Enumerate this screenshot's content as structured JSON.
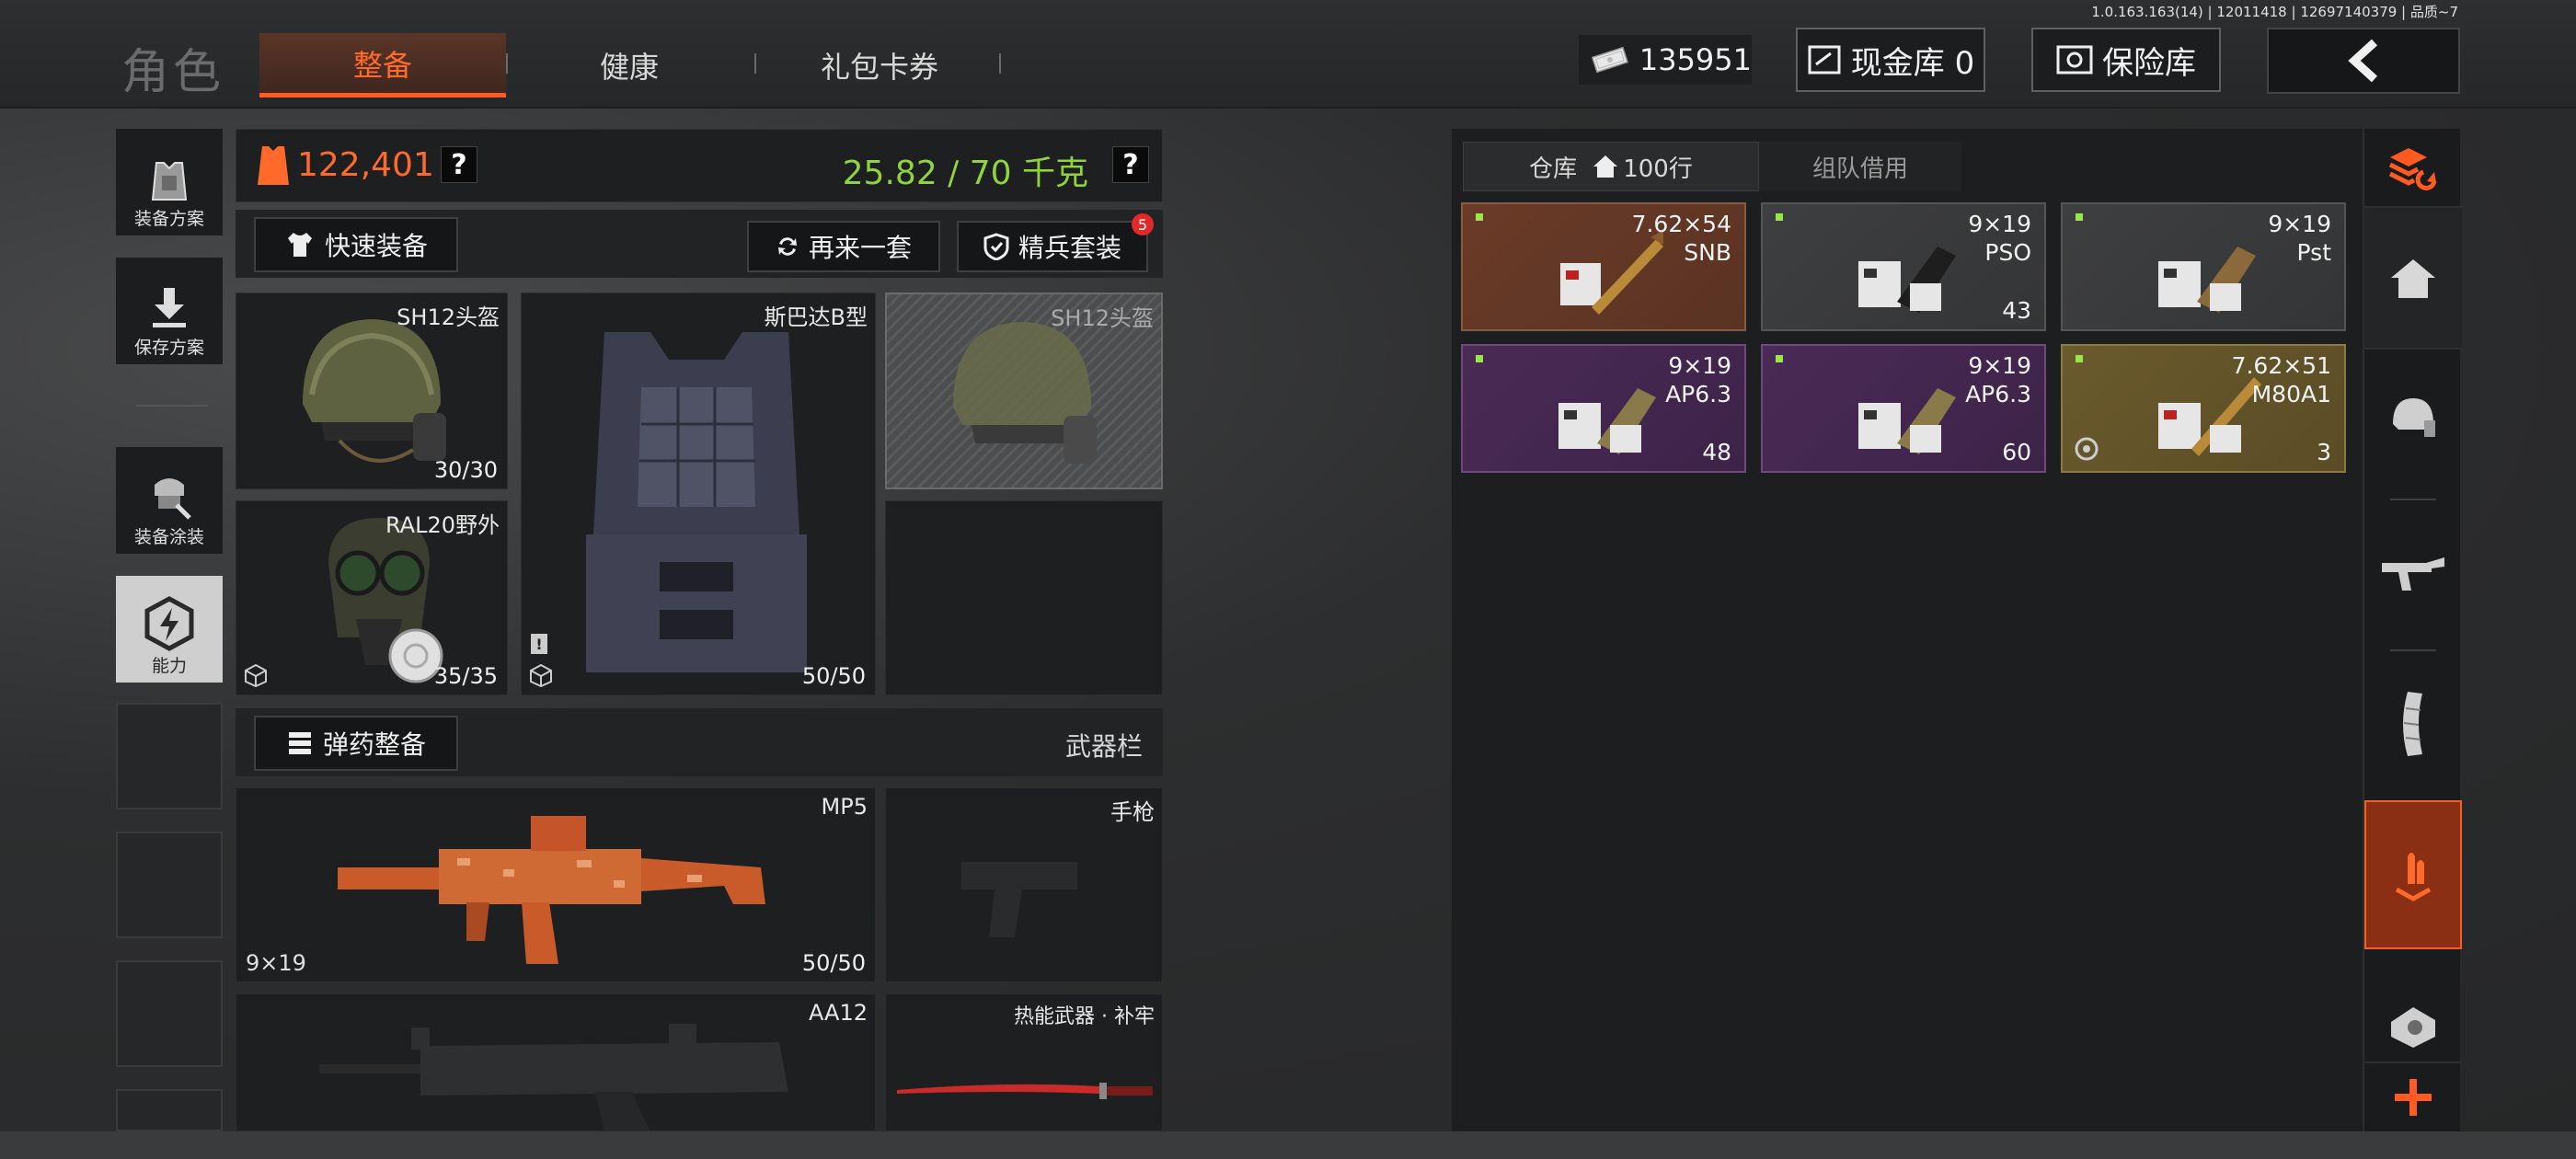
{
  "version": "1.0.163.163(14) | 12011418 | 12697140379 | 品质~7",
  "header": {
    "title": "角色",
    "tabs": [
      {
        "label": "整备",
        "active": true
      },
      {
        "label": "健康",
        "active": false
      },
      {
        "label": "礼包卡券",
        "active": false
      }
    ],
    "money": "135951",
    "cash_vault": "现金库 0",
    "safe_vault": "保险库"
  },
  "sidebar": {
    "items": [
      {
        "label": "装备方案",
        "icon": "armor-plan-icon"
      },
      {
        "label": "保存方案",
        "icon": "save-download-icon"
      },
      {
        "label": "装备涂装",
        "icon": "paint-skin-icon"
      },
      {
        "label": "能力",
        "icon": "lightning-ability-icon"
      }
    ]
  },
  "loadout": {
    "value": "122,401",
    "weight": "25.82 / 70 千克",
    "help": "?",
    "quick_equip": "快速装备",
    "again_set": "再来一套",
    "elite_set": "精兵套装",
    "elite_badge": "5",
    "slots": {
      "helmet": {
        "name": "SH12头盔",
        "durability": "30/30"
      },
      "armor": {
        "name": "斯巴达B型",
        "durability": "50/50"
      },
      "helmet_skin": {
        "name": "SH12头盔"
      },
      "mask": {
        "name": "RAL20野外",
        "durability": "35/35"
      }
    },
    "ammo_equip": "弹药整备",
    "weapon_bar": "武器栏",
    "weapons": {
      "primary": {
        "name": "MP5",
        "caliber": "9×19",
        "ammo": "50/50"
      },
      "pistol": {
        "name": "手枪"
      },
      "secondary": {
        "name": "AA12"
      },
      "melee": {
        "name": "热能武器 · 补牢"
      }
    }
  },
  "storage": {
    "tab_warehouse": "仓库",
    "rows": "100行",
    "tab_team": "组队借用",
    "items": [
      {
        "cal": "7.62×54",
        "type": "SNB",
        "count": "",
        "rarity": "brown"
      },
      {
        "cal": "9×19",
        "type": "PSO",
        "count": "43",
        "rarity": "grey"
      },
      {
        "cal": "9×19",
        "type": "Pst",
        "count": "",
        "rarity": "grey"
      },
      {
        "cal": "9×19",
        "type": "AP6.3",
        "count": "48",
        "rarity": "purple"
      },
      {
        "cal": "9×19",
        "type": "AP6.3",
        "count": "60",
        "rarity": "purple"
      },
      {
        "cal": "7.62×51",
        "type": "M80A1",
        "count": "3",
        "rarity": "gold"
      }
    ]
  },
  "rail": {
    "items": [
      "layers-refresh-icon",
      "home-icon",
      "helmet-icon",
      "rifle-icon",
      "magazine-icon",
      "ammo-icon",
      "scope-icon",
      "plus-icon"
    ],
    "accent": "#ff5a1f"
  }
}
